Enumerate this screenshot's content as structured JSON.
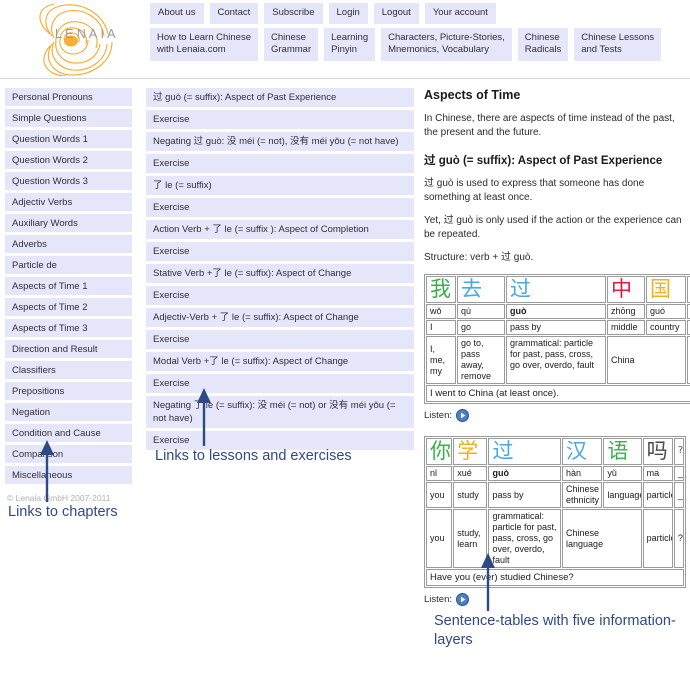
{
  "brand": {
    "name": "LENAIA",
    "logo_icon": "spiral-logo-icon",
    "logo_color": "#f5a623"
  },
  "nav_top": [
    {
      "label": "About us"
    },
    {
      "label": "Contact"
    },
    {
      "label": "Subscribe"
    },
    {
      "label": "Login"
    },
    {
      "label": "Logout"
    },
    {
      "label": "Your account"
    }
  ],
  "nav_main": [
    {
      "label": "How to Learn Chinese\nwith Lenaia.com"
    },
    {
      "label": "Chinese\nGrammar"
    },
    {
      "label": "Learning\nPinyin"
    },
    {
      "label": "Characters, Picture-Stories,\nMnemonics, Vocabulary"
    },
    {
      "label": "Chinese\nRadicals"
    },
    {
      "label": "Chinese Lessons\nand Tests"
    }
  ],
  "sidebar": {
    "items": [
      {
        "label": "Personal Pronouns"
      },
      {
        "label": "Simple Questions"
      },
      {
        "label": "Question Words 1"
      },
      {
        "label": "Question Words 2"
      },
      {
        "label": "Question Words 3"
      },
      {
        "label": "Adjectiv Verbs"
      },
      {
        "label": "Auxiliary Words"
      },
      {
        "label": "Adverbs"
      },
      {
        "label": "Particle de"
      },
      {
        "label": "Aspects of Time 1"
      },
      {
        "label": "Aspects of Time 2"
      },
      {
        "label": "Aspects of Time 3"
      },
      {
        "label": "Direction and Result"
      },
      {
        "label": "Classifiers"
      },
      {
        "label": "Prepositions"
      },
      {
        "label": "Negation"
      },
      {
        "label": "Condition and Cause"
      },
      {
        "label": "Comparison"
      },
      {
        "label": "Miscellaneous"
      }
    ],
    "copyright": "© Lenaia GmbH 2007-2011"
  },
  "lessons": [
    {
      "label": "过 guò (= suffix): Aspect of Past Experience"
    },
    {
      "label": "Exercise"
    },
    {
      "label": "Negating 过 guò: 没 méi (= not), 没有 méi yǒu (= not have)"
    },
    {
      "label": "Exercise"
    },
    {
      "label": "了 le (= suffix)"
    },
    {
      "label": "Exercise"
    },
    {
      "label": "Action Verb + 了 le (= suffix ): Aspect of Completion"
    },
    {
      "label": "Exercise"
    },
    {
      "label": "Stative Verb +了 le (= suffix): Aspect of Change"
    },
    {
      "label": "Exercise"
    },
    {
      "label": "Adjectiv-Verb + 了 le (= suffix): Aspect of Change"
    },
    {
      "label": "Exercise"
    },
    {
      "label": "Modal Verb +了 le (= suffix): Aspect of Change"
    },
    {
      "label": "Exercise"
    },
    {
      "label": "Negating 了 le (= suffix): 没 méi (= not) or 没有 méi yǒu (= not have)"
    },
    {
      "label": "Exercise"
    }
  ],
  "article": {
    "title": "Aspects of Time",
    "intro": "In Chinese, there are aspects of time instead of the past, the present and the future.",
    "section_title": "过 guò (= suffix): Aspect of Past Experience",
    "para1": "过 guò is used to express that someone has done something at least once.",
    "para2": "Yet, 过 guò is only used if the action or the experience can be repeated.",
    "para3": "Structure: verb + 过 guò.",
    "listen_label": "Listen:",
    "play_icon": "play-circle-icon"
  },
  "tables": [
    {
      "id": "table-wo-qu-guo",
      "hanzi": [
        {
          "char": "我",
          "color": "#3bb04a"
        },
        {
          "char": "去",
          "color": "#4aa8e0"
        },
        {
          "char": "过",
          "color": "#4aa8e0"
        },
        {
          "char": "中",
          "color": "#e01b3c"
        },
        {
          "char": "国",
          "color": "#f2b01e"
        },
        {
          "char": "。",
          "color": "#555555"
        }
      ],
      "pinyin": [
        "wǒ",
        "qù",
        "guò",
        "zhōng",
        "guó",
        "_"
      ],
      "pinyin_bold_index": 2,
      "meaning": [
        "I",
        "go",
        "pass by",
        "middle",
        "country",
        "_"
      ],
      "detail": [
        "I, me, my",
        "go to, pass away, remove",
        "grammatical: particle for past, pass, cross, go over, overdo, fault",
        "China",
        "。"
      ],
      "translation": "I went to China (at least once)."
    },
    {
      "id": "table-ni-xue-guo",
      "hanzi": [
        {
          "char": "你",
          "color": "#3bb04a"
        },
        {
          "char": "学",
          "color": "#f2b01e"
        },
        {
          "char": "过",
          "color": "#4aa8e0"
        },
        {
          "char": "汉",
          "color": "#4aa8e0"
        },
        {
          "char": "语",
          "color": "#3bb04a"
        },
        {
          "char": "吗",
          "color": "#4a4a4a"
        },
        {
          "char": "?",
          "color": "#555555"
        }
      ],
      "pinyin": [
        "nǐ",
        "xué",
        "guò",
        "hàn",
        "yǔ",
        "ma",
        "_"
      ],
      "pinyin_bold_index": 2,
      "meaning": [
        "you",
        "study",
        "pass by",
        "Chinese ethnicity",
        "language",
        "particle",
        "_"
      ],
      "detail": [
        "you",
        "study, learn",
        "grammatical: particle for past, pass, cross, go over, overdo, fault",
        "Chinese language",
        "particle",
        "?"
      ],
      "translation": "Have you (ever) studied Chinese?"
    }
  ],
  "annotations": [
    {
      "id": "anno-chapters",
      "text": "Links to chapters"
    },
    {
      "id": "anno-lessons",
      "text": "Links to lessons and exercises"
    },
    {
      "id": "anno-tables",
      "text": "Sentence-tables with five information-layers"
    }
  ]
}
